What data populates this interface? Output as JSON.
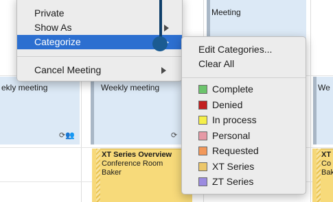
{
  "calendar": {
    "events": {
      "top_meeting": "Meeting",
      "weekly_left": "ekly meeting",
      "weekly_mid": "Weekly meeting",
      "weekly_right": "We",
      "xt_mid_lines": [
        "XT Series Overview",
        "Conference Room",
        "Baker"
      ],
      "xt_right_lines": [
        "XT",
        "Co",
        "Bak"
      ]
    },
    "sync_icon_left": "⟳👥",
    "sync_icon_mid": "⟳"
  },
  "context_menu": {
    "items": [
      {
        "label": "Private",
        "has_submenu": false,
        "selected": false
      },
      {
        "label": "Show As",
        "has_submenu": true,
        "selected": false
      },
      {
        "label": "Categorize",
        "has_submenu": true,
        "selected": true
      },
      {
        "label": "Cancel Meeting",
        "has_submenu": true,
        "selected": false
      }
    ]
  },
  "submenu": {
    "actions": [
      {
        "label": "Edit Categories..."
      },
      {
        "label": "Clear All"
      }
    ],
    "categories": [
      {
        "label": "Complete",
        "color": "#6cc46c"
      },
      {
        "label": "Denied",
        "color": "#c21f1f"
      },
      {
        "label": "In process",
        "color": "#f5ef4a"
      },
      {
        "label": "Personal",
        "color": "#e69aa6"
      },
      {
        "label": "Requested",
        "color": "#f2985a"
      },
      {
        "label": "XT Series",
        "color": "#ecc76a"
      },
      {
        "label": "ZT Series",
        "color": "#9b8be0"
      }
    ]
  },
  "colors": {
    "selection": "#2c6fd0",
    "menu_bg": "#ececec",
    "event_blue": "#dce9f6",
    "event_yellow": "#f7da7a"
  }
}
